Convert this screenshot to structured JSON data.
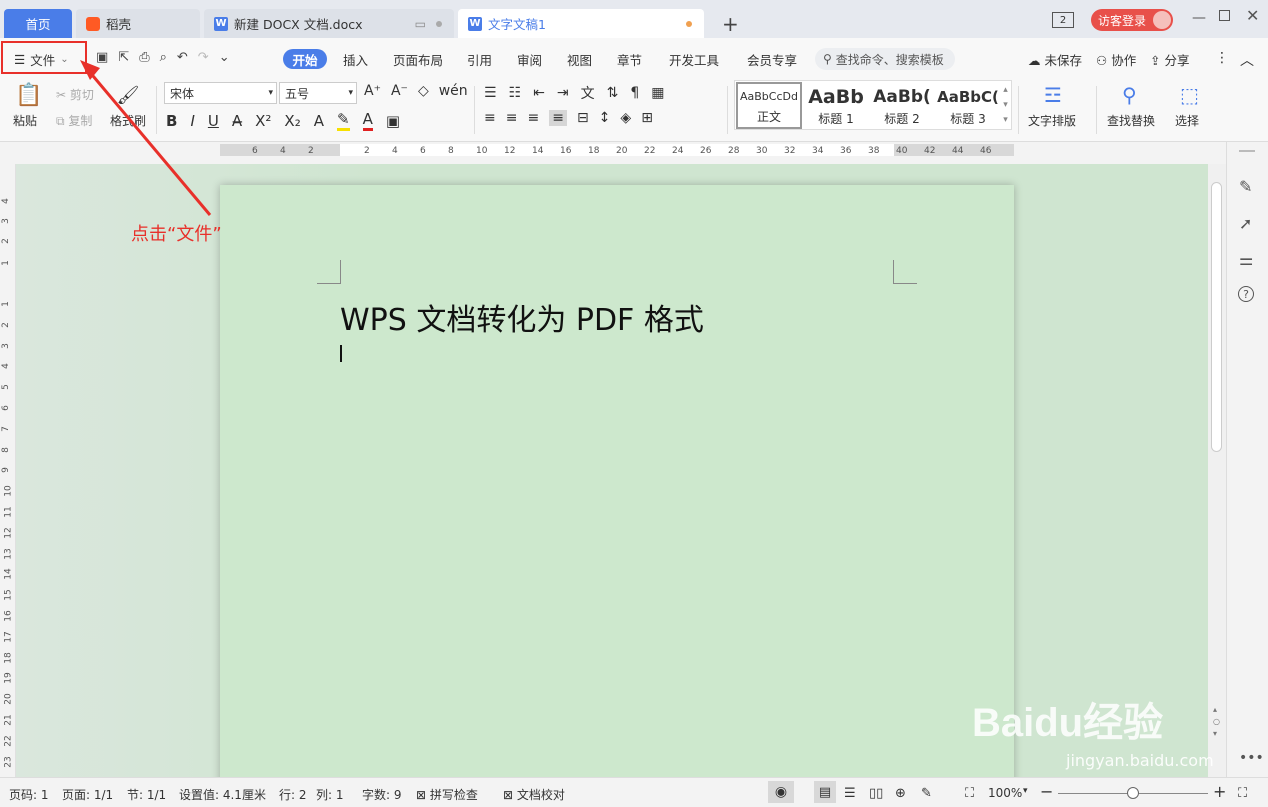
{
  "tabs": {
    "home": "首页",
    "daoke": "稻壳",
    "doc1": "新建 DOCX 文档.docx",
    "doc2": "文字文稿1",
    "window_count": "2",
    "login": "访客登录"
  },
  "menu": {
    "file": "文件",
    "start": "开始",
    "insert": "插入",
    "layout": "页面布局",
    "references": "引用",
    "review": "审阅",
    "view": "视图",
    "chapter": "章节",
    "devtools": "开发工具",
    "member": "会员专享",
    "search_placeholder": "查找命令、搜索模板",
    "unsaved": "未保存",
    "collab": "协作",
    "share": "分享"
  },
  "ribbon": {
    "paste": "粘贴",
    "cut": "剪切",
    "copy": "复制",
    "format_painter": "格式刷",
    "font": "宋体",
    "size": "五号",
    "styles": [
      {
        "preview": "AaBbCcDd",
        "name": "正文"
      },
      {
        "preview": "AaBb",
        "name": "标题 1"
      },
      {
        "preview": "AaBb(",
        "name": "标题 2"
      },
      {
        "preview": "AaBbC(",
        "name": "标题 3"
      }
    ],
    "text_layout": "文字排版",
    "find_replace": "查找替换",
    "select": "选择"
  },
  "ruler": {
    "h_ticks": [
      "6",
      "4",
      "2",
      "2",
      "4",
      "6",
      "8",
      "10",
      "12",
      "14",
      "16",
      "18",
      "20",
      "22",
      "24",
      "26",
      "28",
      "30",
      "32",
      "34",
      "36",
      "38",
      "40",
      "42",
      "44",
      "46"
    ],
    "v_ticks_top": [
      "4",
      "3",
      "2",
      "1"
    ],
    "v_ticks": [
      "1",
      "2",
      "3",
      "4",
      "5",
      "6",
      "7",
      "8",
      "9",
      "10",
      "11",
      "12",
      "13",
      "14",
      "15",
      "16",
      "17",
      "18",
      "19",
      "20",
      "21",
      "22",
      "23"
    ]
  },
  "document": {
    "title_line": "WPS 文档转化为 PDF 格式"
  },
  "annotation": "点击“文件”",
  "status": {
    "page_no": "页码: 1",
    "pages": "页面: 1/1",
    "section": "节: 1/1",
    "setting": "设置值: 4.1厘米",
    "row": "行: 2",
    "col": "列: 1",
    "words": "字数: 9",
    "spell": "拼写检查",
    "proof": "文档校对",
    "zoom": "100%"
  },
  "watermark": {
    "brand": "Baidu经验",
    "url": "jingyan.baidu.com"
  }
}
